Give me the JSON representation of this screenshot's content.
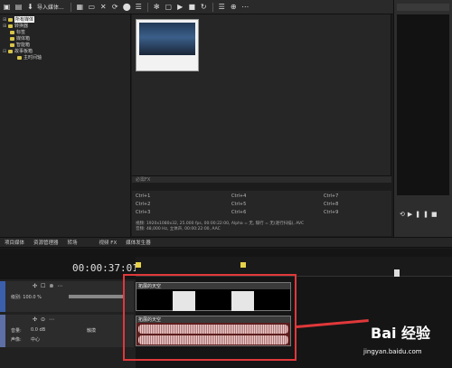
{
  "toolbar": {
    "import_label": "导入媒体..."
  },
  "tree": {
    "items": [
      {
        "label": "所有媒体",
        "selected": true,
        "indent": 0,
        "expander": "⊞"
      },
      {
        "label": "转换器",
        "indent": 0,
        "expander": "⊞"
      },
      {
        "label": "标签",
        "indent": 1
      },
      {
        "label": "媒体箱",
        "indent": 1
      },
      {
        "label": "智能箱",
        "indent": 1
      },
      {
        "label": "故事板箱",
        "indent": 0,
        "expander": "⊟"
      },
      {
        "label": "主时间轴",
        "indent": 1
      }
    ]
  },
  "fx": {
    "label": "必需FX"
  },
  "shortcuts": [
    [
      "Ctrl+1",
      "Ctrl+4",
      "Ctrl+7"
    ],
    [
      "Ctrl+2",
      "Ctrl+5",
      "Ctrl+8"
    ],
    [
      "Ctrl+3",
      "Ctrl+6",
      "Ctrl+9"
    ]
  ],
  "info": {
    "line1": "视频: 1920x1080x32, 25.000 fps, 00:00:22:00, Alpha = 无, 隔行 = 无(逐行扫描), AVC",
    "line2": "音频: 48,000 Hz, 立体声, 00:00:22:00, AAC"
  },
  "tabs": [
    "项目媒体",
    "资源管理器",
    "转场",
    "视频 FX",
    "媒体发生器"
  ],
  "timeline": {
    "timecode": "00:00:37:01"
  },
  "track_video": {
    "level": "级别: 100.0 %"
  },
  "track_audio": {
    "vol_label": "音量:",
    "vol_value": "0.0 dB",
    "pan_label": "声像:",
    "pan_value": "中心",
    "bus_label": "触摸"
  },
  "clips": {
    "video_title": "拓展的天空",
    "audio_title": "拓展的天空"
  },
  "watermark": {
    "brand": "Bai 经验",
    "url": "jingyan.baidu.com"
  },
  "colors": {
    "video_track": "#3b5faa",
    "audio_track": "#5e6fa5",
    "highlight": "#e0383a"
  }
}
